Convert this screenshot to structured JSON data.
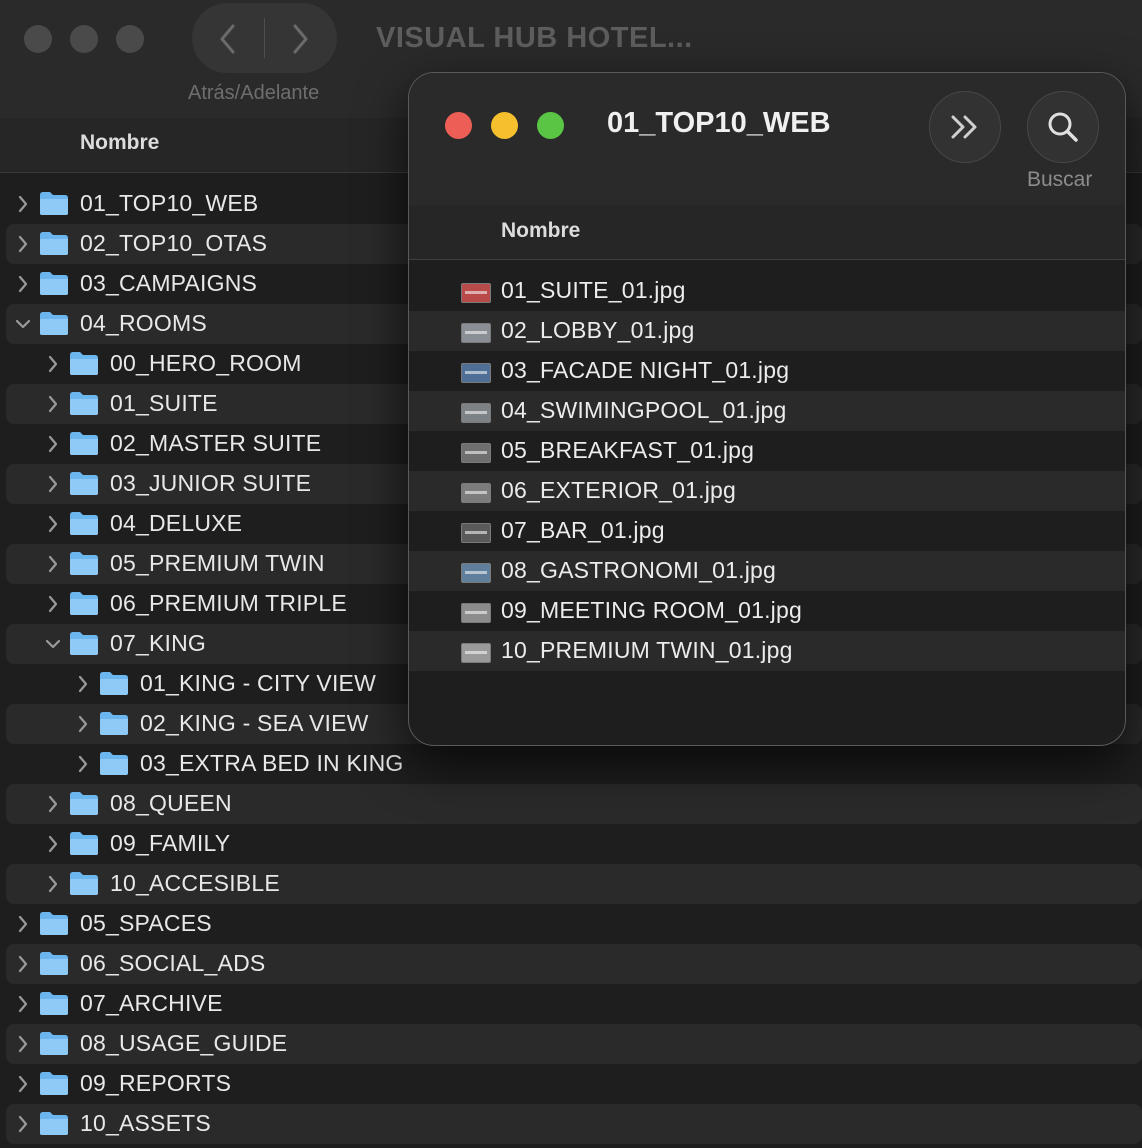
{
  "back_window": {
    "title": "VISUAL HUB HOTEL...",
    "nav_caption": "Atrás/Adelante",
    "column_header": "Nombre",
    "tree": [
      {
        "label": "01_TOP10_WEB",
        "depth": 0,
        "expanded": false
      },
      {
        "label": "02_TOP10_OTAS",
        "depth": 0,
        "expanded": false
      },
      {
        "label": "03_CAMPAIGNS",
        "depth": 0,
        "expanded": false
      },
      {
        "label": "04_ROOMS",
        "depth": 0,
        "expanded": true
      },
      {
        "label": "00_HERO_ROOM",
        "depth": 1,
        "expanded": false
      },
      {
        "label": "01_SUITE",
        "depth": 1,
        "expanded": false
      },
      {
        "label": "02_MASTER SUITE",
        "depth": 1,
        "expanded": false
      },
      {
        "label": "03_JUNIOR SUITE",
        "depth": 1,
        "expanded": false
      },
      {
        "label": "04_DELUXE",
        "depth": 1,
        "expanded": false
      },
      {
        "label": "05_PREMIUM TWIN",
        "depth": 1,
        "expanded": false
      },
      {
        "label": "06_PREMIUM TRIPLE",
        "depth": 1,
        "expanded": false
      },
      {
        "label": "07_KING",
        "depth": 1,
        "expanded": true
      },
      {
        "label": "01_KING - CITY VIEW",
        "depth": 2,
        "expanded": false
      },
      {
        "label": "02_KING - SEA VIEW",
        "depth": 2,
        "expanded": false
      },
      {
        "label": "03_EXTRA BED IN KING",
        "depth": 2,
        "expanded": false
      },
      {
        "label": "08_QUEEN",
        "depth": 1,
        "expanded": false
      },
      {
        "label": "09_FAMILY",
        "depth": 1,
        "expanded": false
      },
      {
        "label": "10_ACCESIBLE",
        "depth": 1,
        "expanded": false
      },
      {
        "label": "05_SPACES",
        "depth": 0,
        "expanded": false
      },
      {
        "label": "06_SOCIAL_ADS",
        "depth": 0,
        "expanded": false
      },
      {
        "label": "07_ARCHIVE",
        "depth": 0,
        "expanded": false
      },
      {
        "label": "08_USAGE_GUIDE",
        "depth": 0,
        "expanded": false
      },
      {
        "label": "09_REPORTS",
        "depth": 0,
        "expanded": false
      },
      {
        "label": "10_ASSETS",
        "depth": 0,
        "expanded": false
      }
    ]
  },
  "front_window": {
    "title": "01_TOP10_WEB",
    "search_caption": "Buscar",
    "column_header": "Nombre",
    "files": [
      {
        "name": "01_SUITE_01.jpg",
        "thumb_color": "#b84a4a"
      },
      {
        "name": "02_LOBBY_01.jpg",
        "thumb_color": "#8a8f96"
      },
      {
        "name": "03_FACADE NIGHT_01.jpg",
        "thumb_color": "#4f6f96"
      },
      {
        "name": "04_SWIMINGPOOL_01.jpg",
        "thumb_color": "#7d8287"
      },
      {
        "name": "05_BREAKFAST_01.jpg",
        "thumb_color": "#6f6f6f"
      },
      {
        "name": "06_EXTERIOR_01.jpg",
        "thumb_color": "#7c7c7c"
      },
      {
        "name": "07_BAR_01.jpg",
        "thumb_color": "#5a5a5a"
      },
      {
        "name": "08_GASTRONOMI_01.jpg",
        "thumb_color": "#5f7f9c"
      },
      {
        "name": "09_MEETING ROOM_01.jpg",
        "thumb_color": "#8c8c8c"
      },
      {
        "name": "10_PREMIUM TWIN_01.jpg",
        "thumb_color": "#9a9a9a"
      }
    ]
  },
  "colors": {
    "close": "#ed5f56",
    "minimize": "#f5bf2e",
    "zoom": "#5ac544",
    "folder": "#6bb6ef"
  },
  "icons": {
    "back": "chevron-left-icon",
    "forward": "chevron-right-icon",
    "more": "double-chevron-icon",
    "search": "search-icon"
  }
}
